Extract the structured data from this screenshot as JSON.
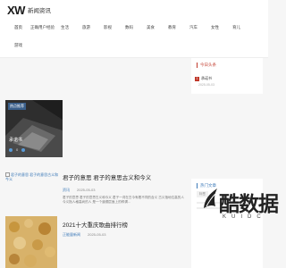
{
  "brand": {
    "logo_mark": "XW",
    "name": "新闻资讯"
  },
  "nav": [
    {
      "label": "首页"
    },
    {
      "label": "正确用户经验"
    },
    {
      "label": "生活"
    },
    {
      "label": "旅游"
    },
    {
      "label": "影视"
    },
    {
      "label": "数码"
    },
    {
      "label": "美食"
    },
    {
      "label": "教育"
    },
    {
      "label": "汽车"
    },
    {
      "label": "女性"
    },
    {
      "label": "育儿"
    },
    {
      "label": "游戏"
    }
  ],
  "featured": {
    "badge": "热点推荐",
    "title": "承诺书",
    "views": "0"
  },
  "articles": [
    {
      "thumb_alt": "君子的意思 君子的意思古义和今义",
      "title": "君子的意思 君子的意思古义和今义",
      "category": "资讯",
      "date": "2025-05-03",
      "excerpt": "君子的意思 君子的意思古义和今义 君子一词在古今有着不同的含义 古义指地位高的人 今义指人格高尚的人 是一个道德层面上的称谓..."
    },
    {
      "title": "2021十大重庆歌曲排行榜",
      "category": "正能量新闻",
      "date": "2025-05-03"
    }
  ],
  "sidebar": {
    "hot_title": "今日头条",
    "hot_items": [
      {
        "num": "1",
        "title": "承诺书",
        "date": "2025-05-03"
      }
    ],
    "tags_title": "热门文章",
    "tag_chip": "标签"
  },
  "watermark": {
    "main": "酷数据",
    "sub": "KUIDC"
  },
  "colors": {
    "accent_red": "#c0392b",
    "accent_blue": "#3d7ab8"
  }
}
